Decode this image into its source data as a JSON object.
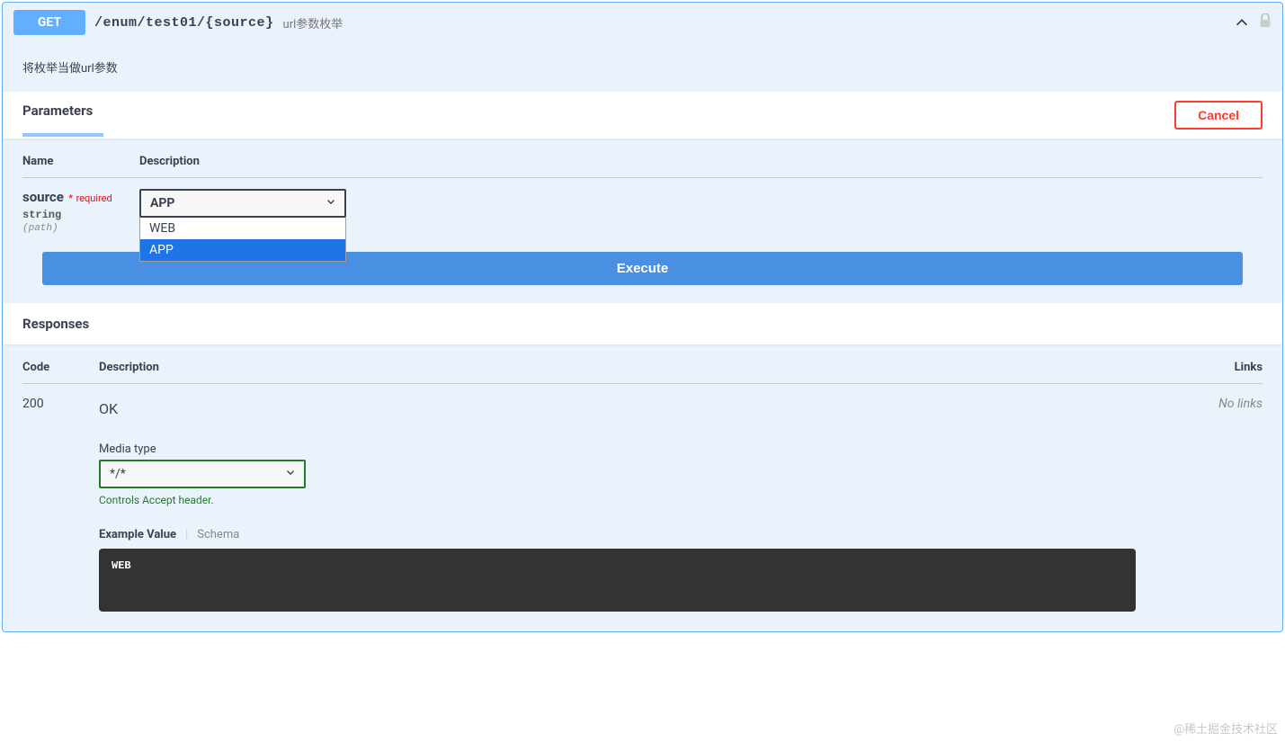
{
  "op": {
    "method": "GET",
    "path": "/enum/test01/{source}",
    "summary": "url参数枚举",
    "description": "将枚举当做url参数"
  },
  "parameters": {
    "title": "Parameters",
    "cancel_label": "Cancel",
    "cols": {
      "name": "Name",
      "description": "Description"
    },
    "row": {
      "name": "source",
      "required_star": "*",
      "required_text": "required",
      "type": "string",
      "in": "(path)",
      "selected": "APP",
      "options": [
        "WEB",
        "APP"
      ],
      "highlighted": "APP"
    }
  },
  "execute_label": "Execute",
  "responses": {
    "title": "Responses",
    "cols": {
      "code": "Code",
      "description": "Description",
      "links": "Links"
    },
    "row": {
      "code": "200",
      "message": "OK",
      "no_links": "No links",
      "media_label": "Media type",
      "media_value": "*/*",
      "accept_note": "Controls Accept header.",
      "tab_example": "Example Value",
      "tab_schema": "Schema",
      "example_body": "WEB"
    }
  },
  "watermark": "@稀土掘金技术社区"
}
